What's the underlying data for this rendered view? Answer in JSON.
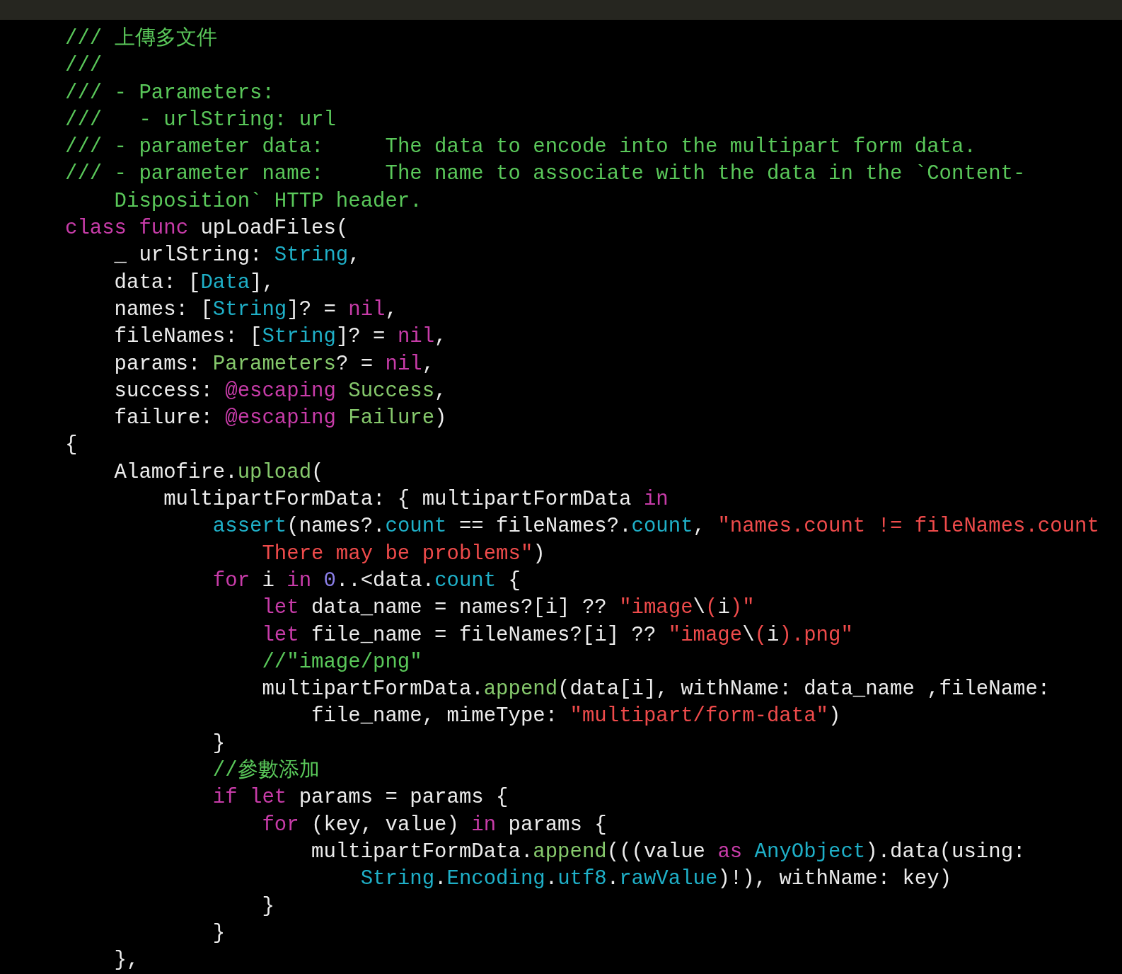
{
  "editor": {
    "lines": [
      {
        "tokens": [
          {
            "kind": "comment",
            "text": "/// 上傳多文件"
          }
        ]
      },
      {
        "tokens": [
          {
            "kind": "comment",
            "text": "///"
          }
        ]
      },
      {
        "tokens": [
          {
            "kind": "comment",
            "text": "/// - Parameters:"
          }
        ]
      },
      {
        "tokens": [
          {
            "kind": "comment",
            "text": "///   - urlString: url"
          }
        ]
      },
      {
        "tokens": [
          {
            "kind": "comment",
            "text": "/// - parameter data:     The data to encode into the multipart form data."
          }
        ]
      },
      {
        "tokens": [
          {
            "kind": "comment",
            "text": "/// - parameter name:     The name to associate with the data in the `Content-"
          }
        ]
      },
      {
        "tokens": [
          {
            "kind": "comment",
            "text": "    Disposition` HTTP header."
          }
        ]
      },
      {
        "tokens": [
          {
            "kind": "keyword",
            "text": "class "
          },
          {
            "kind": "keyword",
            "text": "func"
          },
          {
            "kind": "plain",
            "text": " upLoadFiles("
          }
        ]
      },
      {
        "tokens": [
          {
            "kind": "plain",
            "text": "    _ urlString: "
          },
          {
            "kind": "system",
            "text": "String"
          },
          {
            "kind": "plain",
            "text": ","
          }
        ]
      },
      {
        "tokens": [
          {
            "kind": "plain",
            "text": "    data: ["
          },
          {
            "kind": "system",
            "text": "Data"
          },
          {
            "kind": "plain",
            "text": "],"
          }
        ]
      },
      {
        "tokens": [
          {
            "kind": "plain",
            "text": "    names: ["
          },
          {
            "kind": "system",
            "text": "String"
          },
          {
            "kind": "plain",
            "text": "]? = "
          },
          {
            "kind": "keyword",
            "text": "nil"
          },
          {
            "kind": "plain",
            "text": ","
          }
        ]
      },
      {
        "tokens": [
          {
            "kind": "plain",
            "text": "    fileNames: ["
          },
          {
            "kind": "system",
            "text": "String"
          },
          {
            "kind": "plain",
            "text": "]? = "
          },
          {
            "kind": "keyword",
            "text": "nil"
          },
          {
            "kind": "plain",
            "text": ","
          }
        ]
      },
      {
        "tokens": [
          {
            "kind": "plain",
            "text": "    params: "
          },
          {
            "kind": "project",
            "text": "Parameters"
          },
          {
            "kind": "plain",
            "text": "? = "
          },
          {
            "kind": "keyword",
            "text": "nil"
          },
          {
            "kind": "plain",
            "text": ","
          }
        ]
      },
      {
        "tokens": [
          {
            "kind": "plain",
            "text": "    success: "
          },
          {
            "kind": "keyword",
            "text": "@escaping "
          },
          {
            "kind": "project",
            "text": "Success"
          },
          {
            "kind": "plain",
            "text": ","
          }
        ]
      },
      {
        "tokens": [
          {
            "kind": "plain",
            "text": "    failure: "
          },
          {
            "kind": "keyword",
            "text": "@escaping "
          },
          {
            "kind": "project",
            "text": "Failure"
          },
          {
            "kind": "plain",
            "text": ")"
          }
        ]
      },
      {
        "tokens": [
          {
            "kind": "plain",
            "text": "{"
          }
        ]
      },
      {
        "tokens": [
          {
            "kind": "plain",
            "text": "    Alamofire."
          },
          {
            "kind": "project",
            "text": "upload"
          },
          {
            "kind": "plain",
            "text": "("
          }
        ]
      },
      {
        "tokens": [
          {
            "kind": "plain",
            "text": "        multipartFormData: { multipartFormData "
          },
          {
            "kind": "keyword",
            "text": "in"
          }
        ]
      },
      {
        "tokens": [
          {
            "kind": "system",
            "text": "            assert"
          },
          {
            "kind": "plain",
            "text": "(names?."
          },
          {
            "kind": "system",
            "text": "count"
          },
          {
            "kind": "plain",
            "text": " == fileNames?."
          },
          {
            "kind": "system",
            "text": "count"
          },
          {
            "kind": "plain",
            "text": ", "
          },
          {
            "kind": "string",
            "text": "\"names.count != fileNames.count"
          }
        ]
      },
      {
        "tokens": [
          {
            "kind": "string",
            "text": "                There may be problems\""
          },
          {
            "kind": "plain",
            "text": ")"
          }
        ]
      },
      {
        "tokens": [
          {
            "kind": "keyword",
            "text": "            for"
          },
          {
            "kind": "plain",
            "text": " i "
          },
          {
            "kind": "keyword",
            "text": "in "
          },
          {
            "kind": "number",
            "text": "0"
          },
          {
            "kind": "plain",
            "text": "..<data."
          },
          {
            "kind": "system",
            "text": "count"
          },
          {
            "kind": "plain",
            "text": " {"
          }
        ]
      },
      {
        "tokens": [
          {
            "kind": "keyword",
            "text": "                let"
          },
          {
            "kind": "plain",
            "text": " data_name = names?[i] ?? "
          },
          {
            "kind": "string",
            "text": "\"image"
          },
          {
            "kind": "plain",
            "text": "\\"
          },
          {
            "kind": "string",
            "text": "("
          },
          {
            "kind": "plain",
            "text": "i"
          },
          {
            "kind": "string",
            "text": ")\""
          }
        ]
      },
      {
        "tokens": [
          {
            "kind": "keyword",
            "text": "                let"
          },
          {
            "kind": "plain",
            "text": " file_name = fileNames?[i] ?? "
          },
          {
            "kind": "string",
            "text": "\"image"
          },
          {
            "kind": "plain",
            "text": "\\"
          },
          {
            "kind": "string",
            "text": "("
          },
          {
            "kind": "plain",
            "text": "i"
          },
          {
            "kind": "string",
            "text": ").png\""
          }
        ]
      },
      {
        "tokens": [
          {
            "kind": "comment",
            "text": "                //\"image/png\""
          }
        ]
      },
      {
        "tokens": [
          {
            "kind": "plain",
            "text": "                multipartFormData."
          },
          {
            "kind": "project",
            "text": "append"
          },
          {
            "kind": "plain",
            "text": "(data[i], withName: data_name ,fileName:"
          }
        ]
      },
      {
        "tokens": [
          {
            "kind": "plain",
            "text": "                    file_name, mimeType: "
          },
          {
            "kind": "string",
            "text": "\"multipart/form-data\""
          },
          {
            "kind": "plain",
            "text": ")"
          }
        ]
      },
      {
        "tokens": [
          {
            "kind": "plain",
            "text": "            }"
          }
        ]
      },
      {
        "tokens": [
          {
            "kind": "comment",
            "text": "            //參數添加"
          }
        ]
      },
      {
        "tokens": [
          {
            "kind": "keyword",
            "text": "            if "
          },
          {
            "kind": "keyword",
            "text": "let"
          },
          {
            "kind": "plain",
            "text": " params = params {"
          }
        ]
      },
      {
        "tokens": [
          {
            "kind": "keyword",
            "text": "                for"
          },
          {
            "kind": "plain",
            "text": " (key, value) "
          },
          {
            "kind": "keyword",
            "text": "in"
          },
          {
            "kind": "plain",
            "text": " params {"
          }
        ]
      },
      {
        "tokens": [
          {
            "kind": "plain",
            "text": "                    multipartFormData."
          },
          {
            "kind": "project",
            "text": "append"
          },
          {
            "kind": "plain",
            "text": "(((value "
          },
          {
            "kind": "keyword",
            "text": "as "
          },
          {
            "kind": "system",
            "text": "AnyObject"
          },
          {
            "kind": "plain",
            "text": ").data(using:"
          }
        ]
      },
      {
        "tokens": [
          {
            "kind": "system",
            "text": "                        String"
          },
          {
            "kind": "plain",
            "text": "."
          },
          {
            "kind": "system",
            "text": "Encoding"
          },
          {
            "kind": "plain",
            "text": "."
          },
          {
            "kind": "system",
            "text": "utf8"
          },
          {
            "kind": "plain",
            "text": "."
          },
          {
            "kind": "system",
            "text": "rawValue"
          },
          {
            "kind": "plain",
            "text": ")!), withName: key)"
          }
        ]
      },
      {
        "tokens": [
          {
            "kind": "plain",
            "text": "                }"
          }
        ]
      },
      {
        "tokens": [
          {
            "kind": "plain",
            "text": "            }"
          }
        ]
      },
      {
        "tokens": [
          {
            "kind": "plain",
            "text": "    },"
          }
        ]
      }
    ]
  }
}
